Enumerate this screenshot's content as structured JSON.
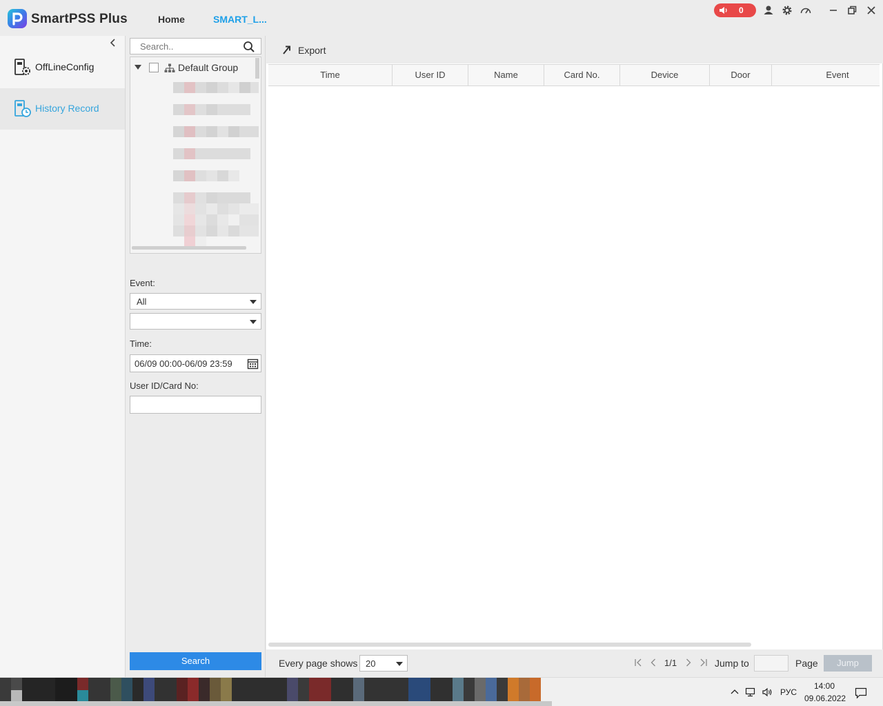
{
  "app": {
    "name": "SmartPSS Plus",
    "tabs": [
      {
        "label": "Home"
      },
      {
        "label": "SMART_L..."
      }
    ],
    "alarm_count": "0",
    "colors": {
      "accent": "#1ea0e8",
      "alarm": "#e84848",
      "primary_button": "#2d8ae6"
    }
  },
  "titlebar_icons": [
    "user-icon",
    "settings-gear-icon",
    "performance-gauge-icon",
    "minimize-icon",
    "restore-icon",
    "close-icon"
  ],
  "sidebar": {
    "items": [
      {
        "label": "OffLineConfig",
        "icon": "offline-config-icon",
        "active": false
      },
      {
        "label": "History Record",
        "icon": "history-record-icon",
        "active": true
      }
    ]
  },
  "filter": {
    "search_placeholder": "Search..",
    "tree": {
      "root_label": "Default Group",
      "expanded": true,
      "checked": false
    },
    "event_label": "Event:",
    "event_value": "All",
    "event_sub_value": "",
    "time_label": "Time:",
    "time_value": "06/09 00:00-06/09 23:59",
    "user_label": "User ID/Card No:",
    "user_value": "",
    "search_button": "Search"
  },
  "main": {
    "toolbar": {
      "export_label": "Export"
    },
    "columns": [
      "Time",
      "User ID",
      "Name",
      "Card No.",
      "Device",
      "Door",
      "Event"
    ],
    "rows": [],
    "footer": {
      "every_page_label": "Every page shows",
      "page_size": "20",
      "page_indicator": "1/1",
      "jump_to_label": "Jump to",
      "page_label": "Page",
      "jump_button": "Jump"
    }
  },
  "taskbar": {
    "language": "РУС",
    "time": "14:00",
    "date": "09.06.2022"
  }
}
